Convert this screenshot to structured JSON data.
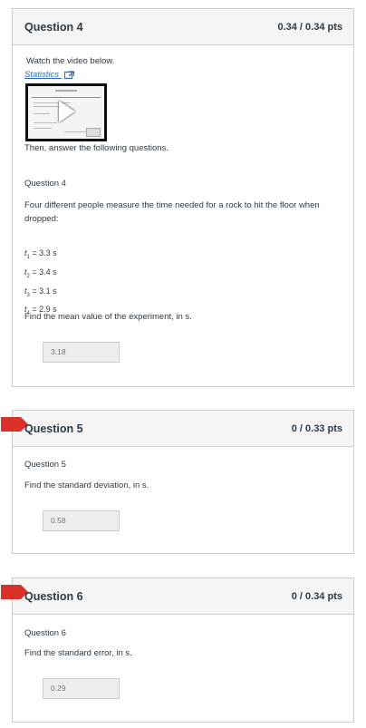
{
  "questions": [
    {
      "title": "Question 4",
      "points": "0.34 / 0.34 pts",
      "intro": "Watch the video below.",
      "video_link": "Statistics",
      "after_video": "Then, answer the following questions.",
      "sub_title": "Question 4",
      "prompt": "Four different people measure the time needed for a rock to hit the floor when dropped:",
      "measurements": [
        {
          "var": "t",
          "sub": "1",
          "value": "= 3.3 s"
        },
        {
          "var": "t",
          "sub": "2",
          "value": "= 3.4 s"
        },
        {
          "var": "t",
          "sub": "3",
          "value": "= 3.1 s"
        },
        {
          "var": "t",
          "sub": "4",
          "value": "= 2.9 s"
        }
      ],
      "ask": "Find the mean value of the experiment, in s.",
      "answer": "3.18"
    },
    {
      "title": "Question 5",
      "points": "0 / 0.33 pts",
      "sub_title": "Question 5",
      "ask": "Find the standard deviation, in s.",
      "answer": "0.58"
    },
    {
      "title": "Question 6",
      "points": "0 / 0.34 pts",
      "sub_title": "Question 6",
      "ask": "Find the standard error, in s.",
      "answer": "0.29"
    }
  ],
  "colors": {
    "flag": "#d9312a",
    "link": "#2d6bc4",
    "header_bg": "#f5f5f5"
  },
  "icons": {
    "external_link": "external-link-icon",
    "play": "play-icon",
    "flag": "flag-icon"
  }
}
